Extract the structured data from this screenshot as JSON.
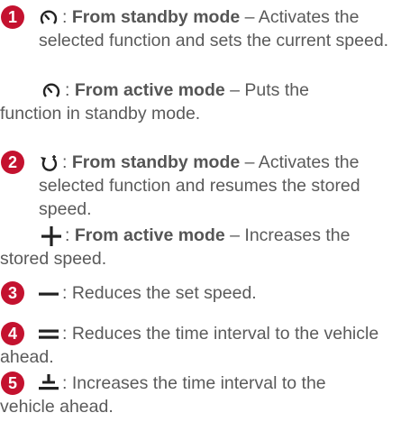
{
  "items": [
    {
      "number": "1",
      "icon": "speedometer-icon",
      "paragraphs": [
        {
          "sep": ": ",
          "title": "From standby mode",
          "text": " – Activates the selected function and sets the current speed."
        },
        {
          "sep": ": ",
          "title": "From active mode",
          "text": " – Puts the function in standby mode."
        }
      ]
    },
    {
      "number": "2",
      "icon": "resume-arrow-icon",
      "paragraphs": [
        {
          "sep": ": ",
          "title": "From standby mode",
          "text": " – Activates the selected function and resumes the stored speed."
        },
        {
          "icon": "plus-icon",
          "sep": ": ",
          "title": "From active mode",
          "text": " – Increases the stored speed."
        }
      ]
    },
    {
      "number": "3",
      "icon": "minus-icon",
      "sep": ": ",
      "text": "Reduces the set speed."
    },
    {
      "number": "4",
      "icon": "distance-decrease-icon",
      "sep": ": ",
      "text": "Reduces the time interval to the vehicle ahead."
    },
    {
      "number": "5",
      "icon": "distance-increase-icon",
      "sep": ": ",
      "text": "Increases the time interval to the vehicle ahead."
    }
  ],
  "colors": {
    "badge": "#c4122f",
    "text": "#5a5a5a",
    "icon": "#222222"
  }
}
